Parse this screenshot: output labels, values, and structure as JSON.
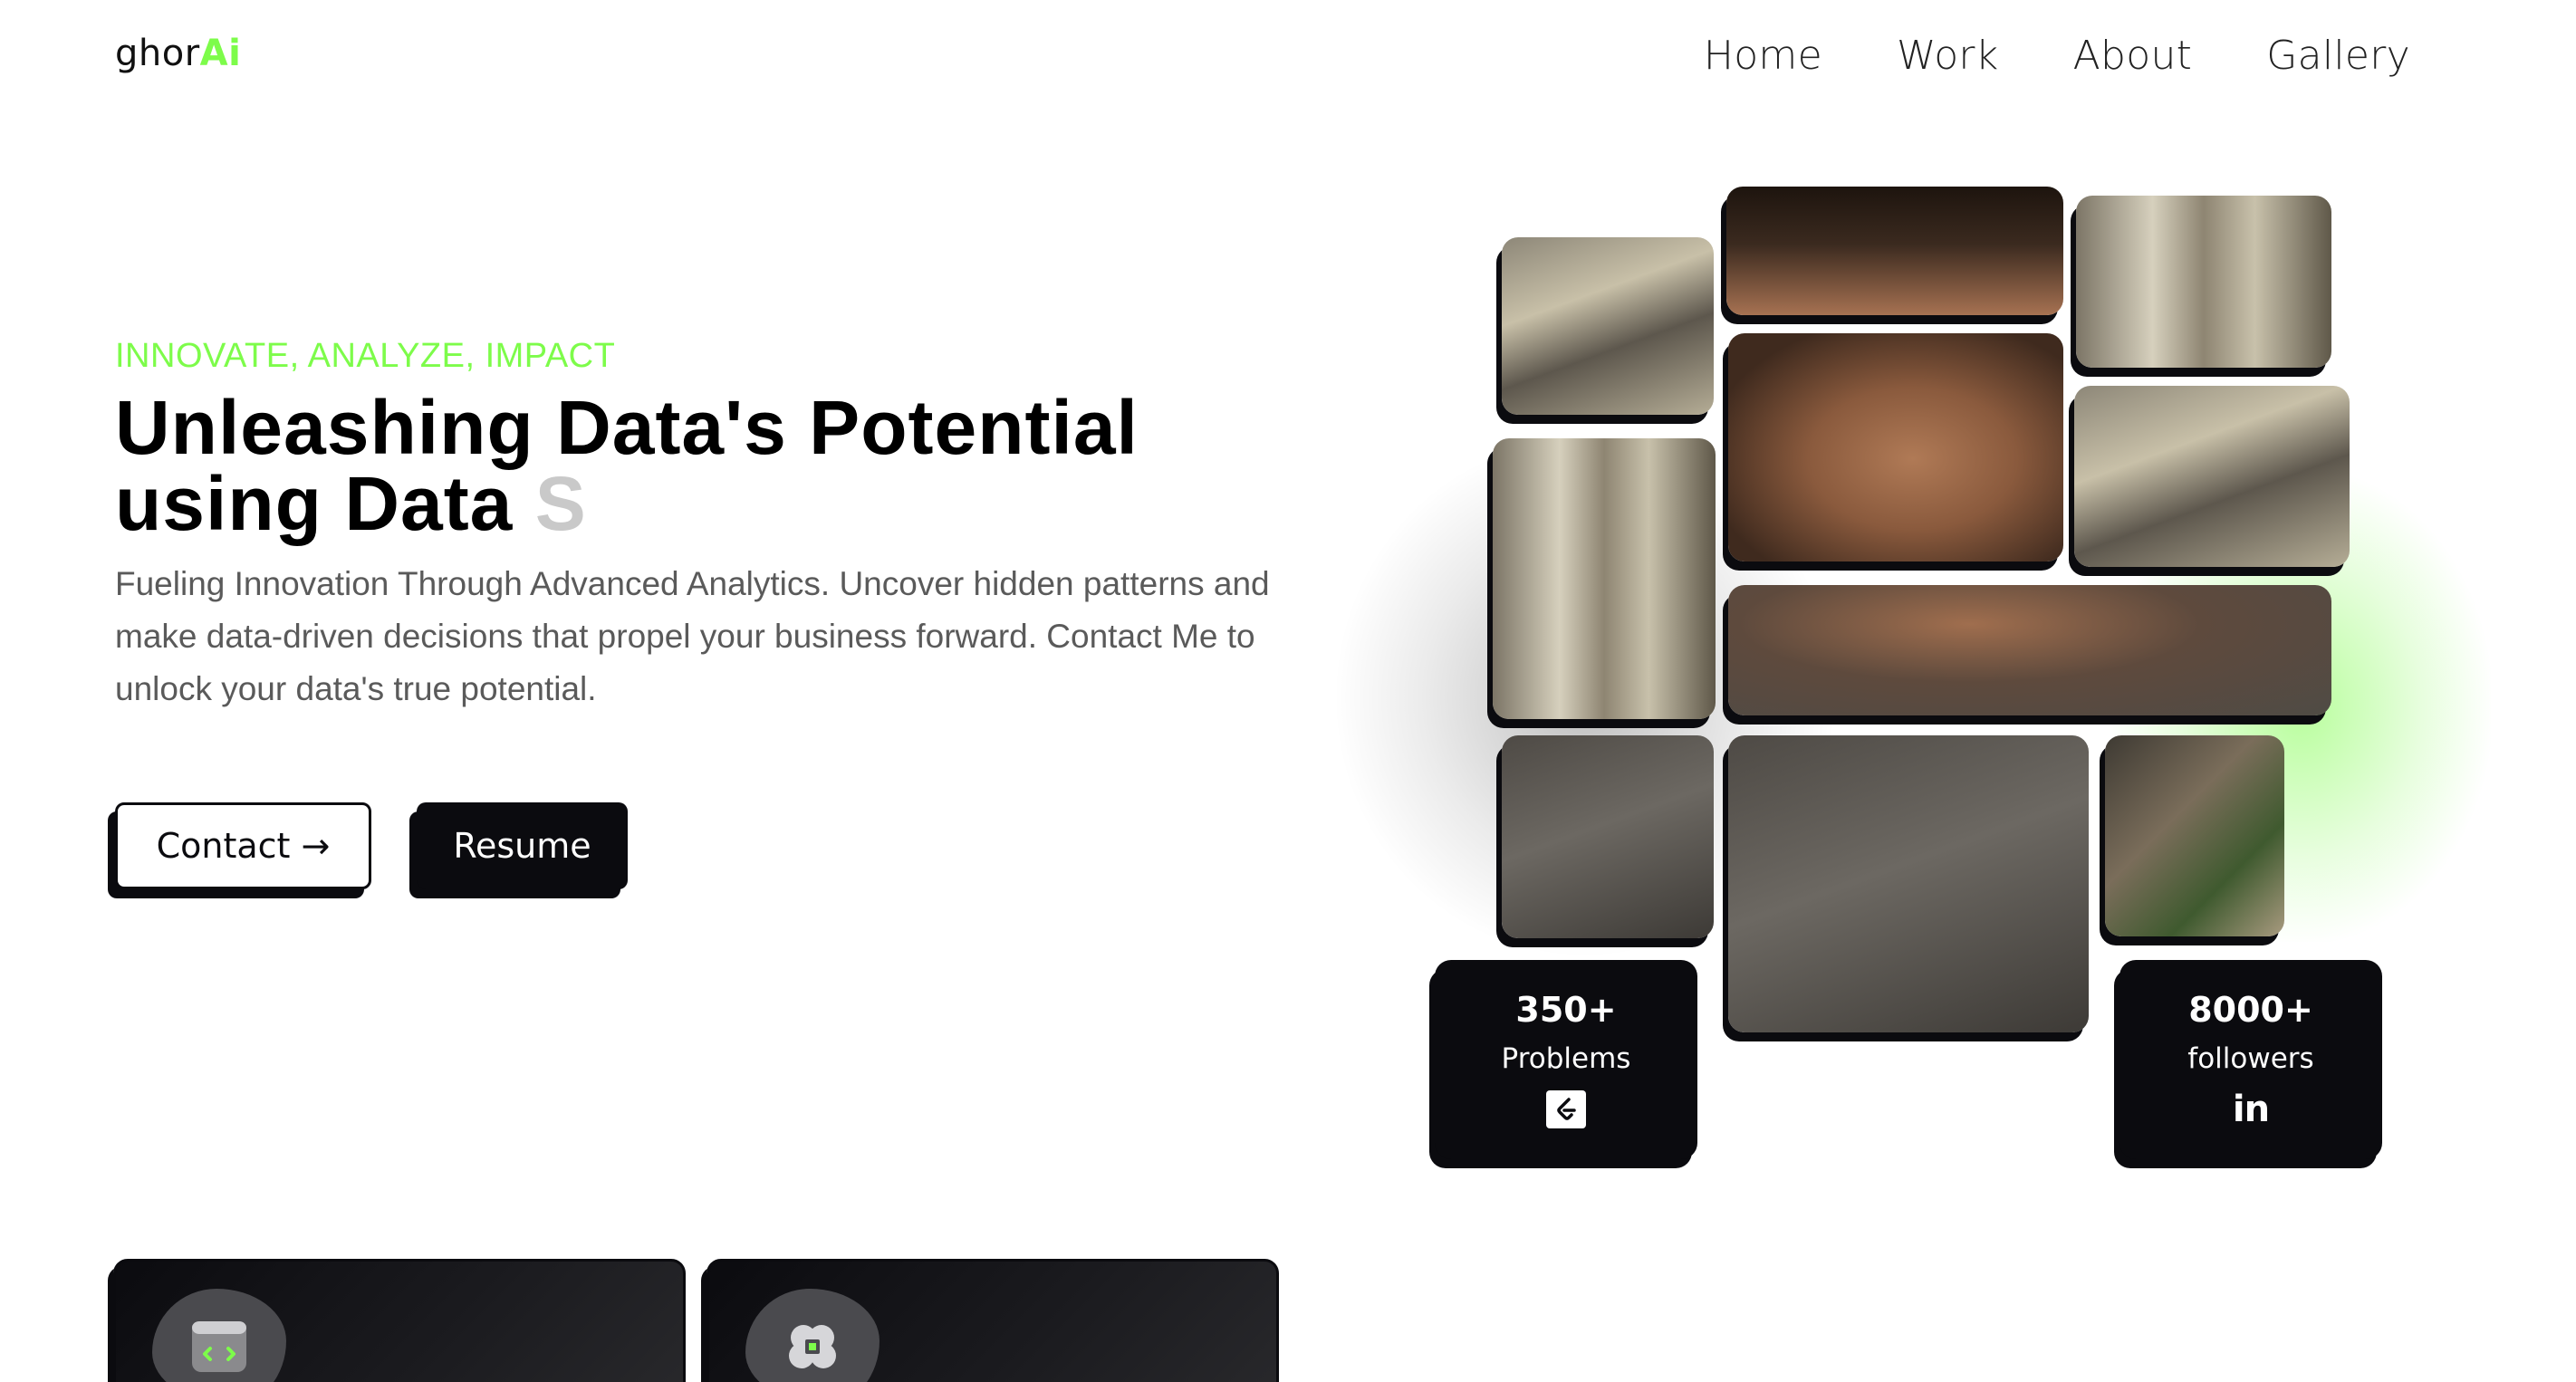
{
  "nav": {
    "logo_main": "ghor",
    "logo_accent": "Ai",
    "items": [
      {
        "label": "Home"
      },
      {
        "label": "Work"
      },
      {
        "label": "About"
      },
      {
        "label": "Gallery"
      }
    ]
  },
  "hero": {
    "tagline": "INNOVATE, ANALYZE, IMPACT",
    "headline_line1": "Unleashing Data's Potential",
    "headline_line2": "using Data",
    "headline_typed": "S",
    "description": "Fueling Innovation Through Advanced Analytics. Uncover hidden patterns and make data-driven decisions that propel your business forward. Contact Me to unlock your data's true potential.",
    "contact_label": "Contact →",
    "resume_label": "Resume"
  },
  "stats": [
    {
      "value": "350+",
      "label": "Problems",
      "icon": "leetcode-icon"
    },
    {
      "value": "8000+",
      "label": "followers",
      "icon": "linkedin-icon"
    }
  ],
  "services": [
    {
      "icon": "code-window-icon"
    },
    {
      "icon": "brain-chip-icon"
    }
  ],
  "colors": {
    "accent": "#7dfc4a",
    "dark": "#0b0b0f",
    "muted_text": "#5a5a5a"
  }
}
